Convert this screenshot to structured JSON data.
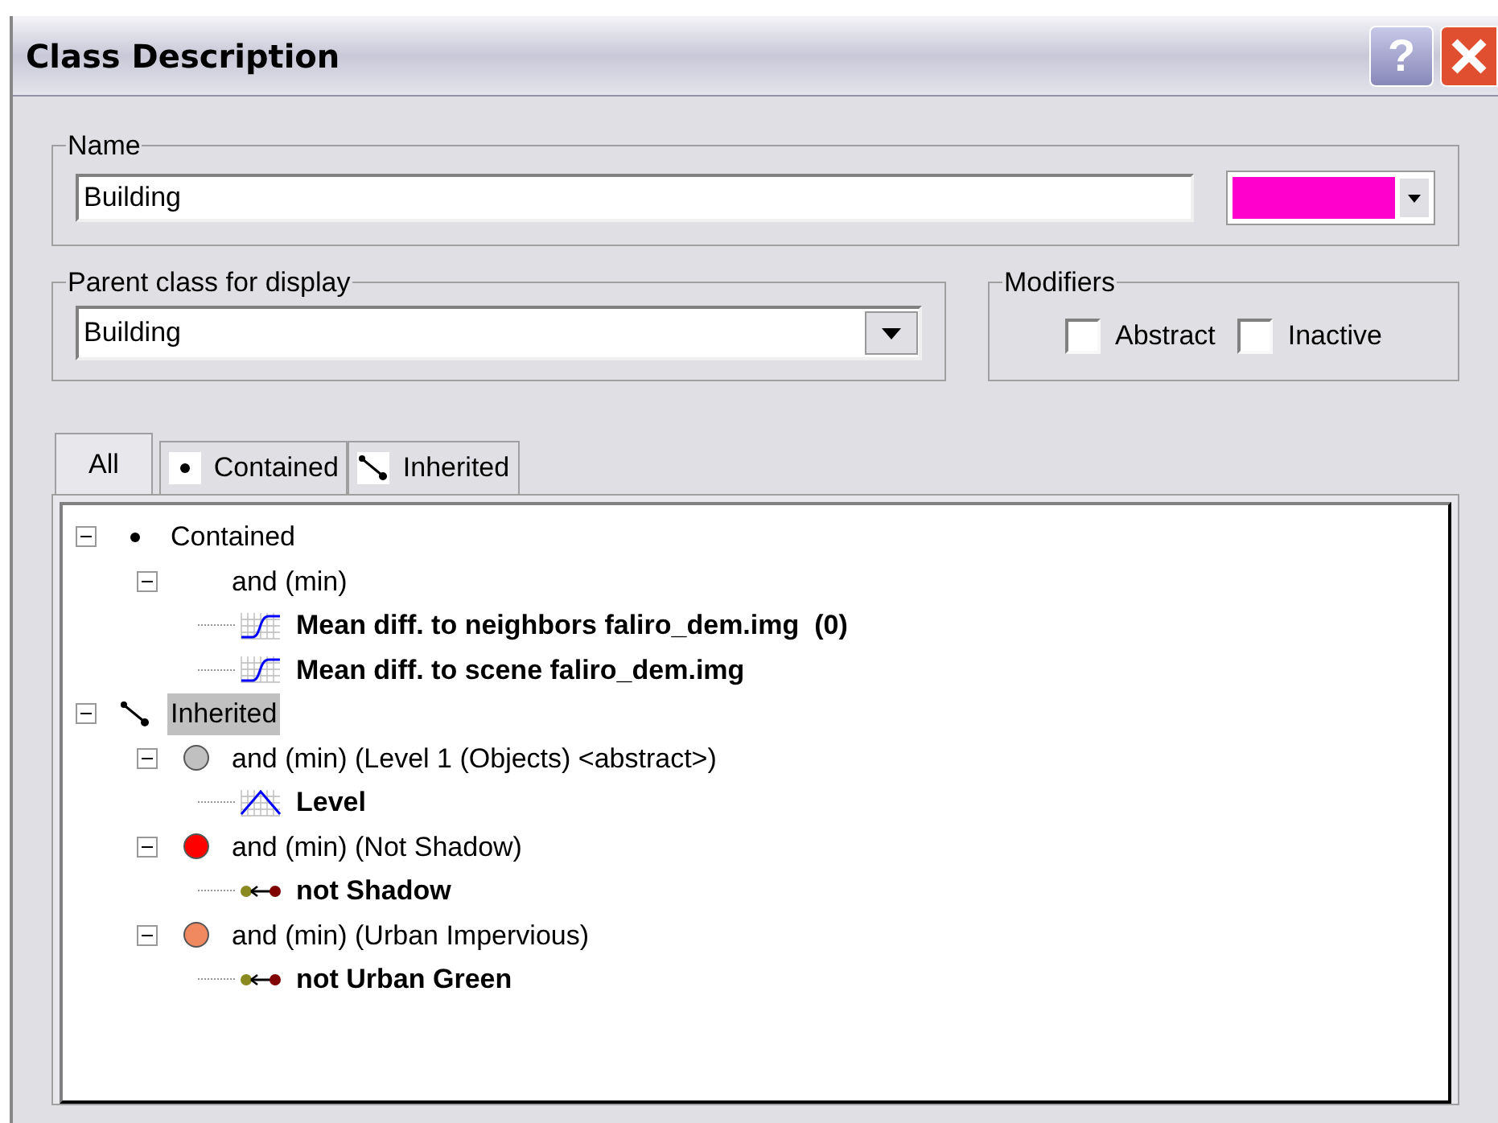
{
  "window": {
    "title": "Class Description",
    "buttons": [
      {
        "kind": "help",
        "label": "?"
      },
      {
        "kind": "close"
      }
    ]
  },
  "name": {
    "legend": "Name",
    "value": "Building",
    "color": "#ff00cc"
  },
  "parent_class": {
    "legend": "Parent class for display",
    "value": "Building"
  },
  "modifiers": {
    "legend": "Modifiers",
    "items": [
      {
        "label": "Abstract",
        "checked": false
      },
      {
        "label": "Inactive",
        "checked": false
      }
    ]
  },
  "tabs": [
    {
      "label": "All",
      "kind": "all",
      "selected": true
    },
    {
      "label": "Contained",
      "kind": "contained",
      "selected": false
    },
    {
      "label": "Inherited",
      "kind": "inherited",
      "selected": false
    }
  ],
  "tree": [
    {
      "label": "Contained",
      "kind": "contained",
      "expanded": true,
      "selected": false,
      "children": [
        {
          "label": "and (min)",
          "kind": "and",
          "expanded": true,
          "selected": false,
          "children": [
            {
              "label": "Mean diff. to neighbors faliro_dem.img  (0)",
              "kind": "sigmoid",
              "selected": false
            },
            {
              "label": "Mean diff. to scene faliro_dem.img",
              "kind": "sigmoid",
              "selected": false
            }
          ]
        }
      ]
    },
    {
      "label": "Inherited",
      "kind": "inherited",
      "expanded": true,
      "selected": true,
      "children": [
        {
          "label": "and (min) (Level 1 (Objects) <abstract>)",
          "kind": "and",
          "color": "#c0c0c0",
          "expanded": true,
          "selected": false,
          "children": [
            {
              "label": "Level",
              "kind": "bell",
              "selected": false
            }
          ]
        },
        {
          "label": "and (min) (Not Shadow)",
          "kind": "and",
          "color": "#ff0000",
          "expanded": true,
          "selected": false,
          "children": [
            {
              "label": "not Shadow",
              "kind": "not",
              "selected": false
            }
          ]
        },
        {
          "label": "and (min) (Urban Impervious)",
          "kind": "and",
          "color": "#f08860",
          "expanded": true,
          "selected": false,
          "children": [
            {
              "label": "not Urban Green",
              "kind": "not",
              "selected": false
            }
          ]
        }
      ]
    }
  ]
}
